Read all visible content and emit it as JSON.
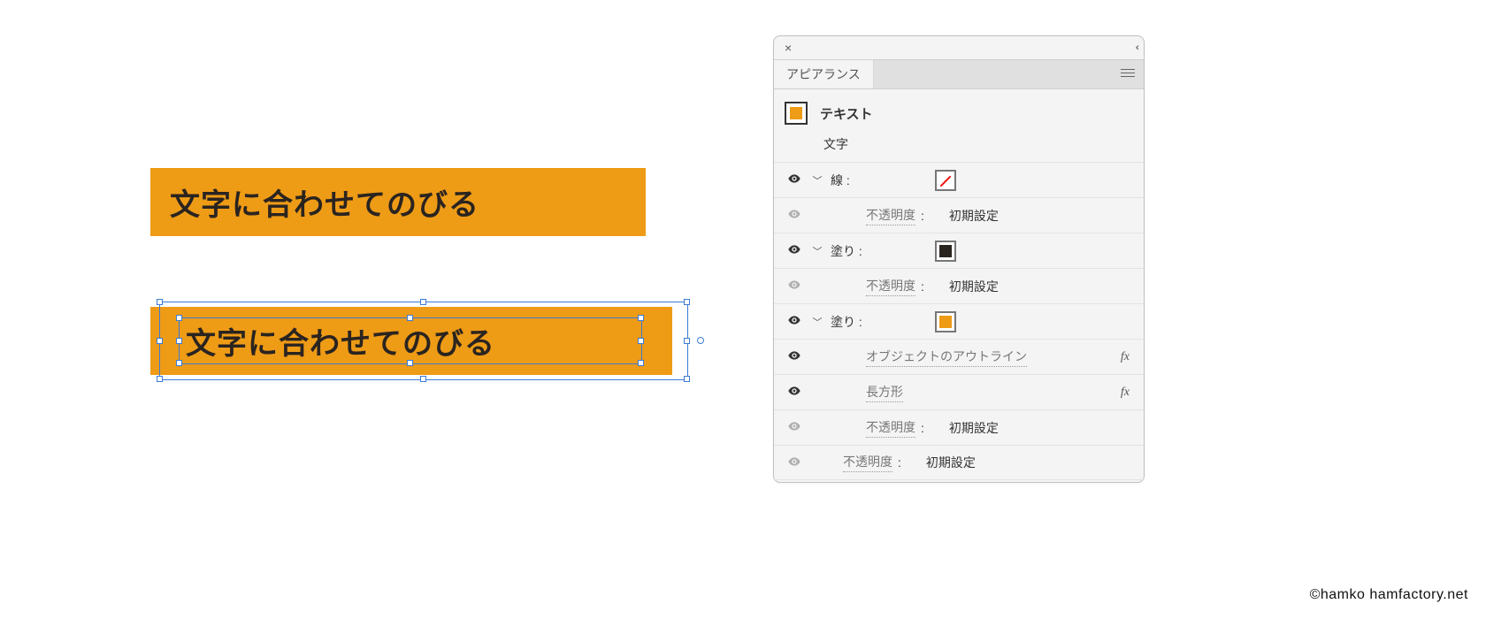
{
  "canvas": {
    "text1": "文字に合わせてのびる",
    "text2": "文字に合わせてのびる"
  },
  "panel": {
    "tab_label": "アピアランス",
    "header": {
      "title": "テキスト",
      "sub": "文字"
    },
    "labels": {
      "stroke": "線",
      "fill": "塗り",
      "opacity": "不透明度",
      "default_value": "初期設定",
      "effect_outline": "オブジェクトのアウトライン",
      "effect_rect": "長方形",
      "fx": "fx"
    },
    "colors": {
      "stroke": "none",
      "fill1": "#2a241f",
      "fill2": "#ee9b16"
    }
  },
  "credit": "©hamko  hamfactory.net"
}
